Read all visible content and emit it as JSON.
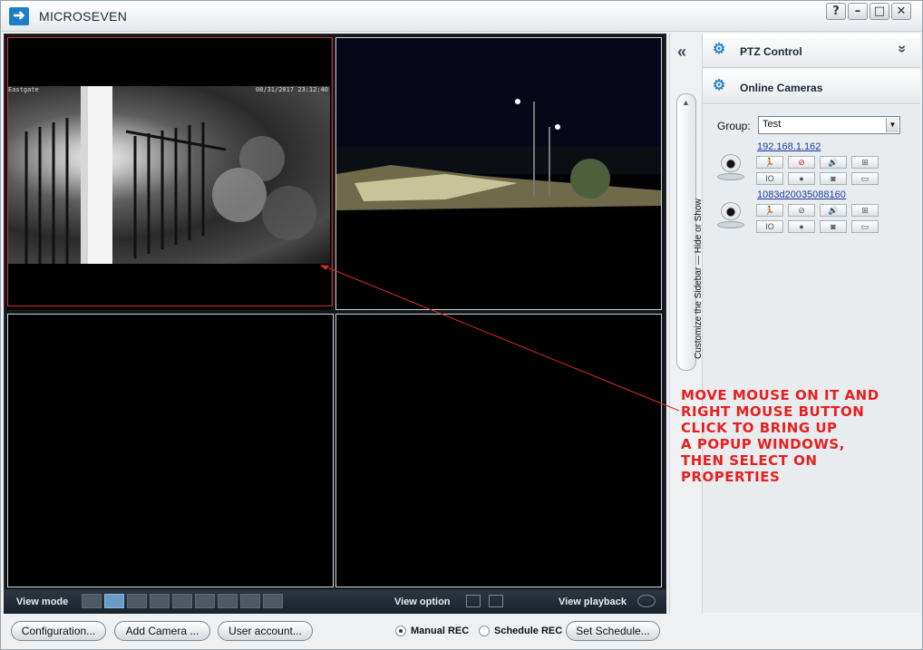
{
  "window": {
    "title": "MICROSEVEN",
    "buttons": [
      "?",
      "–",
      "□",
      "✕"
    ]
  },
  "video": {
    "cam1_label": "Eastgate",
    "cam1_timestamp": "08/31/2017 23:12:40"
  },
  "viewbar": {
    "view_mode": "View mode",
    "view_option": "View option",
    "view_playback": "View playback"
  },
  "bottom": {
    "configuration": "Configuration...",
    "add_camera": "Add Camera ...",
    "user_account": "User account...",
    "manual_rec": "Manual REC",
    "schedule_rec": "Schedule REC",
    "set_schedule": "Set Schedule..."
  },
  "sidebar_toggle": {
    "collapse": "«",
    "text": "Customize the Sidebar — Hide or Show"
  },
  "sidebar": {
    "ptz_title": "PTZ Control",
    "ptz_expand": "»",
    "cameras_title": "Online Cameras",
    "group_label": "Group:",
    "group_value": "Test",
    "cameras": [
      {
        "name": "192.168.1.162"
      },
      {
        "name": "1083d20035088160"
      }
    ]
  },
  "annotation": {
    "text": "MOVE MOUSE ON IT AND\nRIGHT MOUSE BUTTON\nCLICK TO BRING UP\nA POPUP WINDOWS,\nTHEN SELECT ON\nPROPERTIES",
    "color": "#e62020"
  },
  "colors": {
    "accent": "#2d86c7",
    "selection": "#d62b2b",
    "viewbar": "#1b232b"
  }
}
